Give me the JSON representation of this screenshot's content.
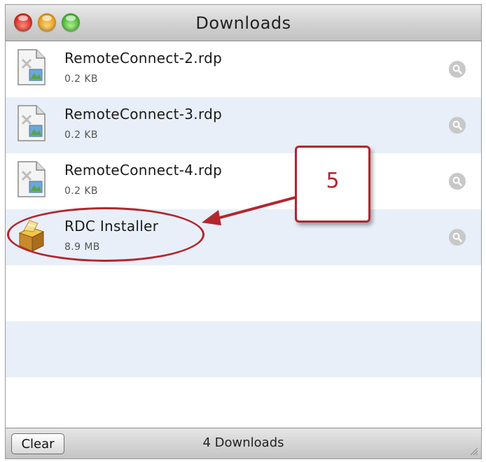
{
  "window": {
    "title": "Downloads"
  },
  "downloads": [
    {
      "name": "RemoteConnect-2.rdp",
      "size": "0.2 KB",
      "icon": "rdp-file-icon"
    },
    {
      "name": "RemoteConnect-3.rdp",
      "size": "0.2 KB",
      "icon": "rdp-file-icon"
    },
    {
      "name": "RemoteConnect-4.rdp",
      "size": "0.2 KB",
      "icon": "rdp-file-icon"
    },
    {
      "name": "RDC Installer",
      "size": "8.9 MB",
      "icon": "package-installer-icon"
    }
  ],
  "footer": {
    "clear_label": "Clear",
    "count_label": "4 Downloads"
  },
  "annotation": {
    "callout_number": "5",
    "color": "#b3262e"
  }
}
